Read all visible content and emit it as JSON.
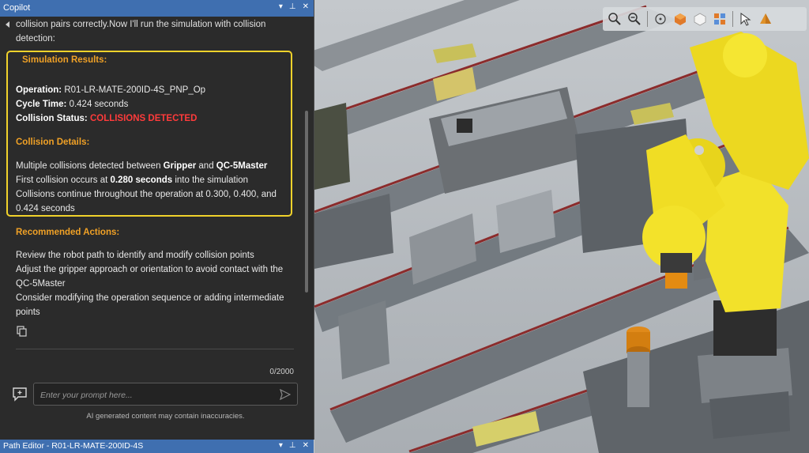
{
  "copilot": {
    "title": "Copilot",
    "intro_line1": "collision pairs correctly.Now I'll run the simulation with collision",
    "intro_line2": "detection:",
    "results_heading": "Simulation Results:",
    "operation_label": "Operation:",
    "operation_value": "R01-LR-MATE-200ID-4S_PNP_Op",
    "cycle_label": "Cycle Time:",
    "cycle_value": "0.424 seconds",
    "status_label": "Collision Status:",
    "status_value": "COLLISIONS DETECTED",
    "details_heading": "Collision Details:",
    "detail1_pre": "Multiple collisions detected between ",
    "detail1_a": "Gripper",
    "detail1_mid": " and ",
    "detail1_b": "QC-5Master",
    "detail2_pre": "First collision occurs at ",
    "detail2_bold": "0.280 seconds",
    "detail2_post": " into the simulation",
    "detail3_line1": "Collisions continue throughout the operation at 0.300, 0.400, and",
    "detail3_line2": "0.424 seconds",
    "actions_heading": "Recommended Actions:",
    "action1": "Review the robot path to identify and modify collision points",
    "action2_line1": "Adjust the gripper approach or orientation to avoid contact with the",
    "action2_line2": "QC-5Master",
    "action3_line1": "Consider modifying the operation sequence or adding intermediate",
    "action3_line2": "points",
    "counter": "0/2000",
    "prompt_placeholder": "Enter your prompt here...",
    "disclaimer": "AI generated content may contain inaccuracies.",
    "colors": {
      "heading": "#f0a126",
      "alert": "#ff3b3b",
      "highlight_border": "#f1d22b",
      "titlebar": "#3f6fb0"
    }
  },
  "path_editor": {
    "title": "Path Editor - R01-LR-MATE-200ID-4S"
  },
  "viewport": {
    "toolbar_icons": [
      "zoom-in-icon",
      "zoom-out-icon",
      "fit-view-icon",
      "shading-icon",
      "cube-view-icon",
      "layout-icon",
      "select-icon",
      "render-mode-icon"
    ]
  }
}
